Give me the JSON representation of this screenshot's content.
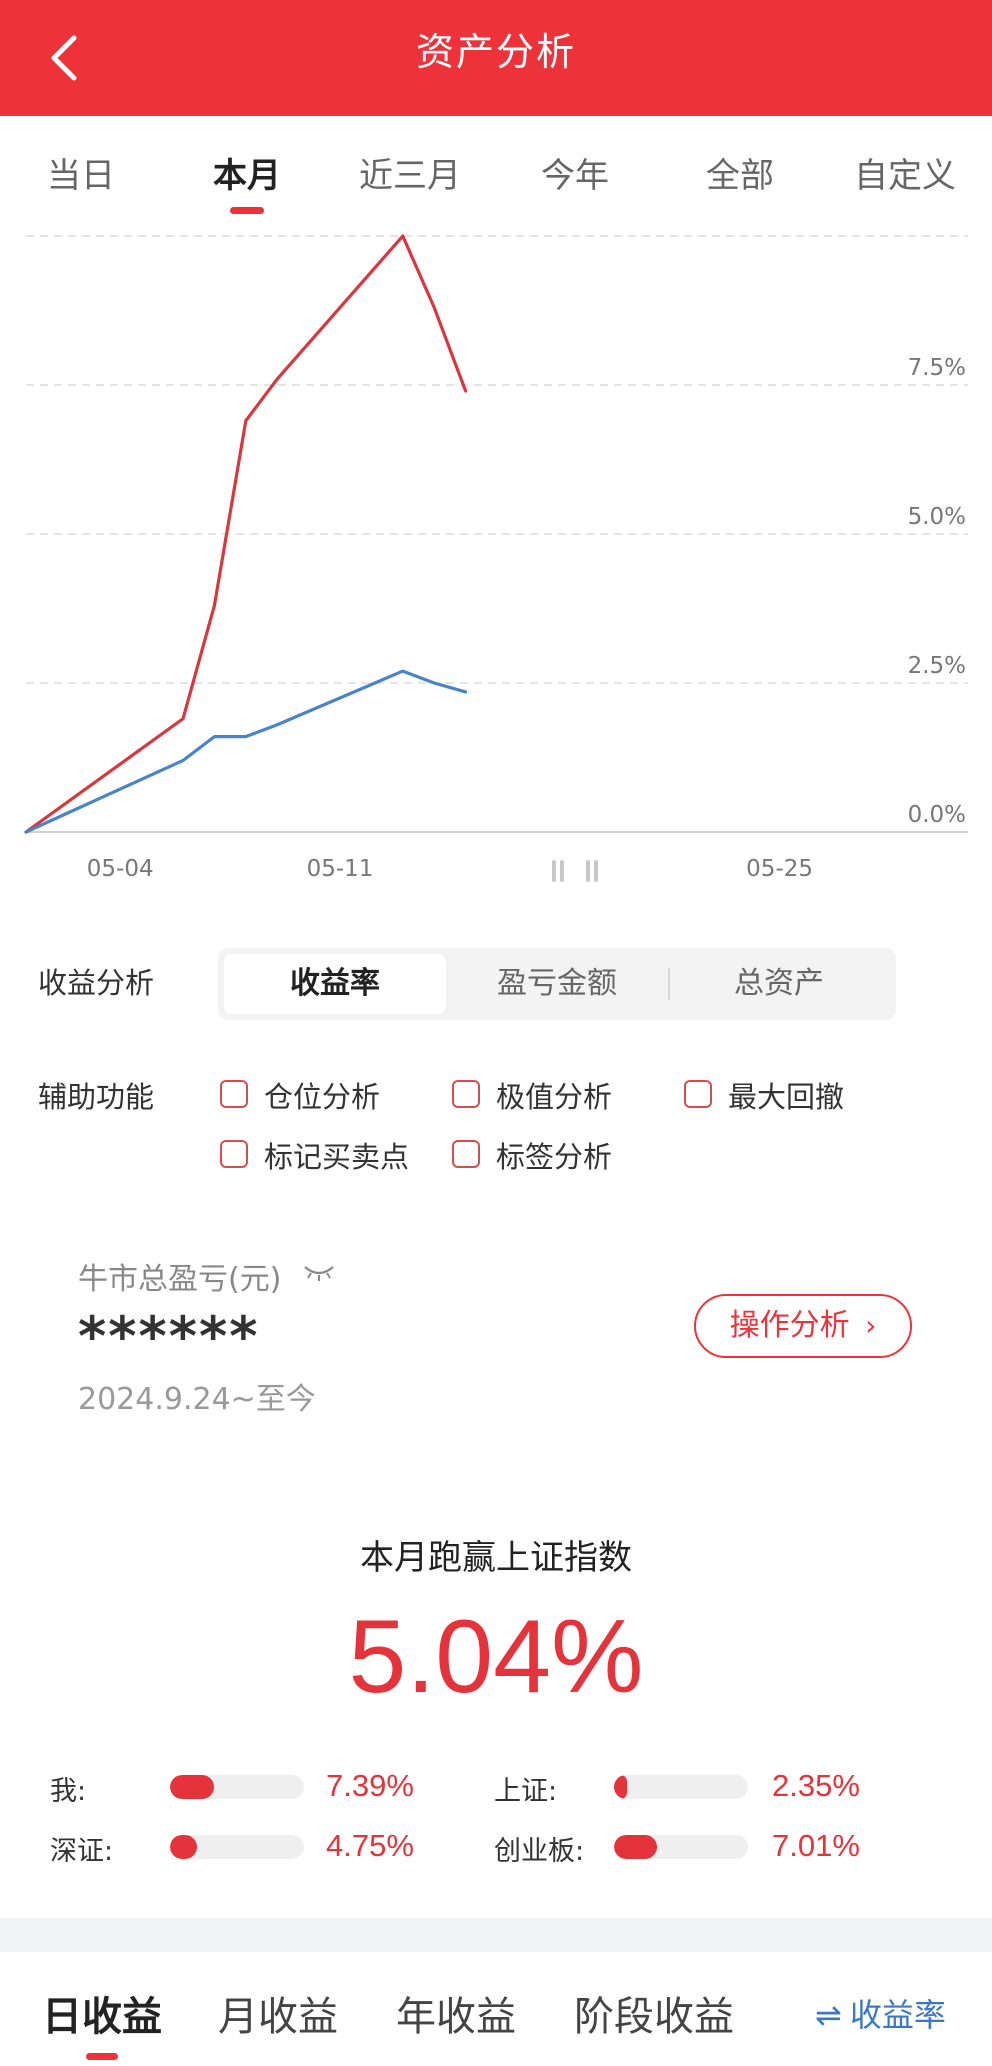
{
  "header": {
    "title": "资产分析",
    "back_icon": "chevron-left-icon"
  },
  "period_tabs": [
    "当日",
    "本月",
    "近三月",
    "今年",
    "全部",
    "自定义"
  ],
  "period_active": "本月",
  "chart_data": {
    "type": "line",
    "x": [
      "05-01",
      "05-06",
      "05-07",
      "05-08",
      "05-09",
      "05-13",
      "05-14",
      "05-15"
    ],
    "xtick_labels": [
      "05-04",
      "05-11",
      "05-25"
    ],
    "yticks": [
      "0.0%",
      "2.5%",
      "5.0%",
      "7.5%"
    ],
    "ylim": [
      0,
      10
    ],
    "grid": true,
    "series": [
      {
        "color": "#d8373d",
        "values": [
          0,
          1.9,
          3.8,
          6.9,
          7.6,
          10.0,
          8.8,
          7.4
        ]
      },
      {
        "color": "#4a84c4",
        "values": [
          0,
          1.2,
          1.6,
          1.6,
          1.8,
          2.7,
          2.5,
          2.35
        ]
      }
    ]
  },
  "analysis": {
    "label": "收益分析",
    "segments": [
      "收益率",
      "盈亏金额",
      "总资产"
    ],
    "active": "收益率"
  },
  "aux": {
    "label": "辅助功能",
    "options": [
      "仓位分析",
      "极值分析",
      "最大回撤",
      "标记买卖点",
      "标签分析"
    ]
  },
  "bull": {
    "label": "牛市总盈亏(元)",
    "eye_icon": "eye-closed-icon",
    "value": "******",
    "period": "2024.9.24~至今",
    "button": "操作分析",
    "button_icon": "chevron-right-icon"
  },
  "beat": {
    "label": "本月跑赢上证指数",
    "value": "5.04%"
  },
  "comparison": [
    {
      "label": "我:",
      "value": "7.39%",
      "fill": 0.33
    },
    {
      "label": "上证:",
      "value": "2.35%",
      "fill": 0.1
    },
    {
      "label": "深证:",
      "value": "4.75%",
      "fill": 0.2
    },
    {
      "label": "创业板:",
      "value": "7.01%",
      "fill": 0.32
    }
  ],
  "bottom_tabs": [
    "日收益",
    "月收益",
    "年收益",
    "阶段收益"
  ],
  "bottom_active": "日收益",
  "yield_toggle": {
    "label": "收益率",
    "icon": "swap-icon"
  }
}
